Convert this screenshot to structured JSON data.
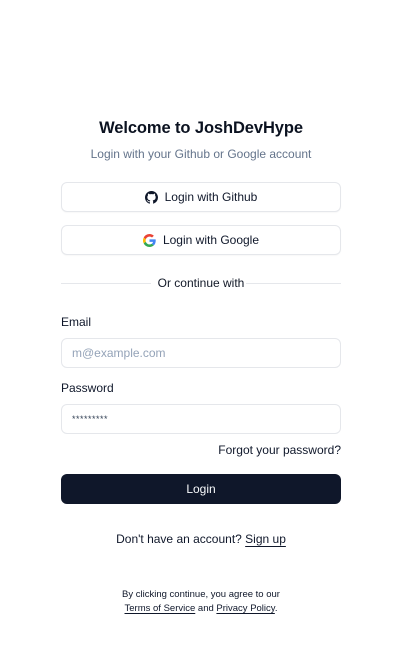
{
  "header": {
    "title": "Welcome to JoshDevHype",
    "subtitle": "Login with your Github or Google account"
  },
  "oauth": {
    "github_label": "Login with Github",
    "github_icon": "github-icon",
    "google_label": "Login with Google",
    "google_icon": "google-icon"
  },
  "divider": {
    "text": "Or continue with"
  },
  "form": {
    "email_label": "Email",
    "email_placeholder": "m@example.com",
    "password_label": "Password",
    "password_value": "*********",
    "forgot_label": "Forgot your password?",
    "login_label": "Login"
  },
  "signup": {
    "prompt": "Don't have an account?",
    "link": "Sign up"
  },
  "legal": {
    "prefix": "By clicking continue, you agree to our",
    "terms": "Terms of Service",
    "and": "and",
    "privacy": "Privacy Policy",
    "suffix": "."
  },
  "colors": {
    "primary": "#0f172a",
    "muted_text": "#64748b",
    "border": "#e5e7eb",
    "google_blue": "#4285F4",
    "google_red": "#EA4335",
    "google_yellow": "#FBBC05",
    "google_green": "#34A853"
  }
}
